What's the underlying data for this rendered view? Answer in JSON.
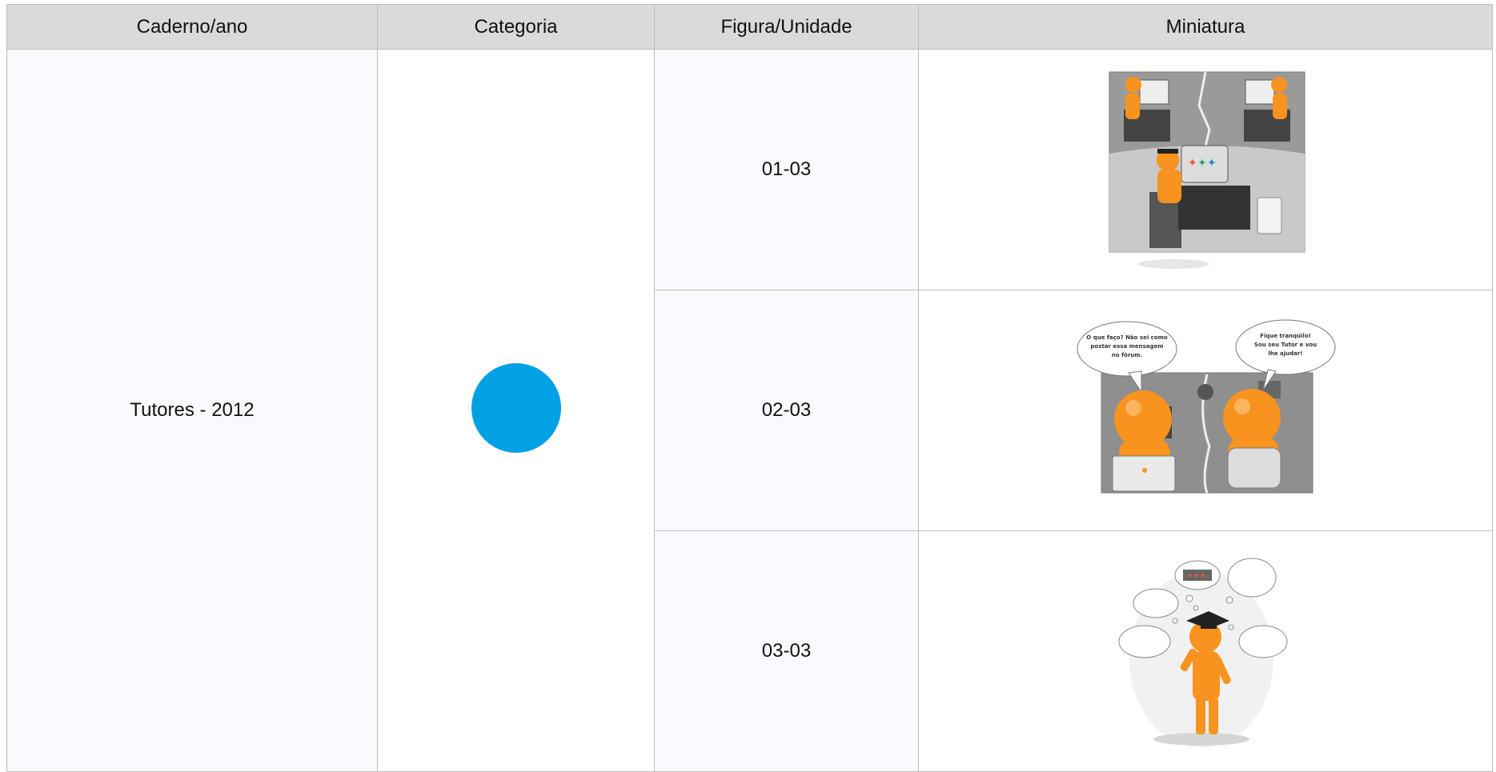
{
  "table": {
    "headers": [
      "Caderno/ano",
      "Categoria",
      "Figura/Unidade",
      "Miniatura"
    ],
    "group": {
      "caderno": "Tutores - 2012",
      "categoria_color": "#00a0e4",
      "categoria_shape": "circle-icon"
    },
    "rows": [
      {
        "figura": "01-03",
        "miniatura": "office-workers-illustration"
      },
      {
        "figura": "02-03",
        "miniatura": "tutor-dialogue-illustration",
        "bubble_left": [
          "O que faço? Não sei como",
          "postar essa mensagem",
          "no fórum."
        ],
        "bubble_right": [
          "Fique tranqüilo!",
          "Sou seu Tutor e vou",
          "lhe ajudar!"
        ]
      },
      {
        "figura": "03-03",
        "miniatura": "graduate-thinking-illustration"
      }
    ]
  },
  "colors": {
    "accent": "#00a0e4",
    "figure_orange": "#f7931e",
    "header_bg": "#dadada",
    "border": "#bdbdbd"
  }
}
